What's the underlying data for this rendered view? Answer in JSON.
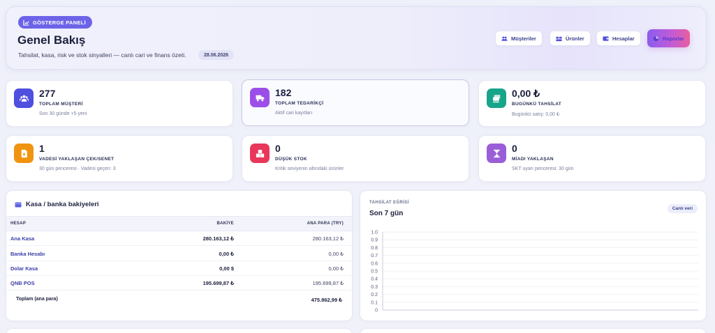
{
  "header": {
    "badge": "GÖSTERGE PANELİ",
    "title": "Genel Bakış",
    "subtitle": "Tahsilat, kasa, risk ve stok sinyalleri — canlı cari ve finans özeti.",
    "date": "28.06.2026",
    "buttons": {
      "customers": "Müşteriler",
      "products": "Ürünler",
      "accounts": "Hesaplar",
      "reports": "Raporlar"
    }
  },
  "cards": [
    {
      "value": "277",
      "label": "TOPLAM MÜŞTERİ",
      "note": "Son 30 günde +5 yeni",
      "icon": "users-icon",
      "color": "#4f4fe0"
    },
    {
      "value": "182",
      "label": "TOPLAM TEDARİKÇİ",
      "note": "Aktif cari kayıtları",
      "icon": "truck-icon",
      "color": "#9b4fe8"
    },
    {
      "value": "0,00 ₺",
      "label": "BUGÜNKÜ TAHSİLAT",
      "note": "Bugünkü satış: 0,00 ₺",
      "icon": "money-icon",
      "color": "#17a58a"
    },
    {
      "value": "1",
      "label": "VADESİ YAKLAŞAN ÇEK/SENET",
      "note": "30 gün penceresi · Vadesi geçen: 3",
      "icon": "document-icon",
      "color": "#f0940f"
    },
    {
      "value": "0",
      "label": "DÜŞÜK STOK",
      "note": "Kritik seviyenin altındaki ürünler",
      "icon": "boxes-icon",
      "color": "#e8375a"
    },
    {
      "value": "0",
      "label": "MİADI YAKLAŞAN",
      "note": "SKT uyarı penceresi: 30 gün",
      "icon": "hourglass-icon",
      "color": "#9a5fd8"
    }
  ],
  "bank": {
    "title": "Kasa / banka bakiyeleri",
    "columns": [
      "HESAP",
      "BAKİYE",
      "ANA PARA (TRY)"
    ],
    "rows": [
      {
        "name": "Ana Kasa",
        "balance": "280.163,12 ₺",
        "main": "280.163,12 ₺"
      },
      {
        "name": "Banka Hesabı",
        "balance": "0,00 ₺",
        "main": "0,00 ₺"
      },
      {
        "name": "Dolar Kasa",
        "balance": "0,00 $",
        "main": "0,00 ₺"
      },
      {
        "name": "QNB POS",
        "balance": "195.699,87 ₺",
        "main": "195.699,87 ₺"
      }
    ],
    "total_label": "Toplam (ana para)",
    "total_value": "475.862,99 ₺"
  },
  "chart": {
    "kicker": "TAHSİLAT EĞRİSİ",
    "title": "Son 7 gün",
    "chip": "Canlı veri"
  },
  "chart_data": {
    "type": "line",
    "title": "Son 7 gün",
    "xlabel": "",
    "ylabel": "",
    "ylim": [
      0,
      1.0
    ],
    "yticks": [
      "1.0",
      "0.9",
      "0.8",
      "0.7",
      "0.6",
      "0.5",
      "0.4",
      "0.3",
      "0.2",
      "0.1",
      "0"
    ],
    "series": [],
    "grid": true
  }
}
